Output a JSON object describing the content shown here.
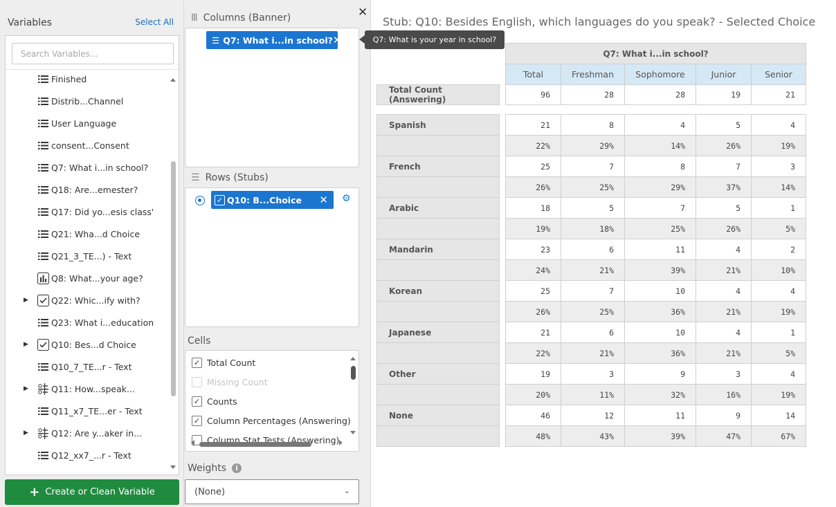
{
  "variables_panel": {
    "title": "Variables",
    "select_all": "Select All",
    "search_placeholder": "Search Variables...",
    "items": [
      {
        "label": "Finished",
        "icon": "list-icon",
        "expandable": false
      },
      {
        "label": "Distrib...Channel",
        "icon": "list-icon",
        "expandable": false
      },
      {
        "label": "User Language",
        "icon": "list-icon",
        "expandable": false
      },
      {
        "label": "consent...Consent",
        "icon": "list-icon",
        "expandable": false
      },
      {
        "label": "Q7: What i...in school?",
        "icon": "list-icon",
        "expandable": false
      },
      {
        "label": "Q18: Are...emester?",
        "icon": "list-icon",
        "expandable": false
      },
      {
        "label": "Q17: Did yo...esis class'",
        "icon": "list-icon",
        "expandable": false
      },
      {
        "label": "Q21: Wha...d Choice",
        "icon": "list-icon",
        "expandable": false
      },
      {
        "label": "Q21_3_TE...) - Text",
        "icon": "list-icon",
        "expandable": false
      },
      {
        "label": "Q8: What...your age?",
        "icon": "bar-chart-icon",
        "expandable": false
      },
      {
        "label": "Q22: Whic...ify with?",
        "icon": "checkbox-icon",
        "expandable": true
      },
      {
        "label": "Q23: What i...education",
        "icon": "list-icon",
        "expandable": false
      },
      {
        "label": "Q10: Bes...d Choice",
        "icon": "checkbox-icon",
        "expandable": true
      },
      {
        "label": "Q10_7_TE...r - Text",
        "icon": "list-icon",
        "expandable": false
      },
      {
        "label": "Q11: How...speak...",
        "icon": "matrix-icon",
        "expandable": true
      },
      {
        "label": "Q11_x7_TE...er - Text",
        "icon": "list-icon",
        "expandable": false
      },
      {
        "label": "Q12: Are y...aker in...",
        "icon": "matrix-icon",
        "expandable": true
      },
      {
        "label": "Q12_xx7_...r - Text",
        "icon": "list-icon",
        "expandable": false
      }
    ],
    "create_button": "Create or Clean Variable"
  },
  "columns_section": {
    "title": "Columns (Banner)",
    "chip_label": "Q7: What i...in school?",
    "tooltip": "Q7: What is your year in school?"
  },
  "rows_section": {
    "title": "Rows (Stubs)",
    "chip_label": "Q10: B...Choice"
  },
  "cells_section": {
    "title": "Cells",
    "options": [
      {
        "label": "Total Count",
        "checked": true,
        "disabled": false
      },
      {
        "label": "Missing Count",
        "checked": false,
        "disabled": true
      },
      {
        "label": "Counts",
        "checked": true,
        "disabled": false
      },
      {
        "label": "Column Percentages (Answering)",
        "checked": true,
        "disabled": false
      },
      {
        "label": "Column Stat Tests (Answering)",
        "checked": false,
        "disabled": false
      }
    ]
  },
  "weights_section": {
    "title": "Weights",
    "selected": "(None)"
  },
  "table": {
    "title": "Stub: Q10: Besides English, which languages do you speak? - Selected Choice",
    "banner": "Q7: What i...in school?",
    "columns": [
      "Total",
      "Freshman",
      "Sophomore",
      "Junior",
      "Senior"
    ],
    "total_label": "Total Count (Answering)",
    "totals": [
      "96",
      "28",
      "28",
      "19",
      "21"
    ],
    "rows": [
      {
        "label": "Spanish",
        "counts": [
          "21",
          "8",
          "4",
          "5",
          "4"
        ],
        "pcts": [
          "22%",
          "29%",
          "14%",
          "26%",
          "19%"
        ]
      },
      {
        "label": "French",
        "counts": [
          "25",
          "7",
          "8",
          "7",
          "3"
        ],
        "pcts": [
          "26%",
          "25%",
          "29%",
          "37%",
          "14%"
        ]
      },
      {
        "label": "Arabic",
        "counts": [
          "18",
          "5",
          "7",
          "5",
          "1"
        ],
        "pcts": [
          "19%",
          "18%",
          "25%",
          "26%",
          "5%"
        ]
      },
      {
        "label": "Mandarin",
        "counts": [
          "23",
          "6",
          "11",
          "4",
          "2"
        ],
        "pcts": [
          "24%",
          "21%",
          "39%",
          "21%",
          "10%"
        ]
      },
      {
        "label": "Korean",
        "counts": [
          "25",
          "7",
          "10",
          "4",
          "4"
        ],
        "pcts": [
          "26%",
          "25%",
          "36%",
          "21%",
          "19%"
        ]
      },
      {
        "label": "Japanese",
        "counts": [
          "21",
          "6",
          "10",
          "4",
          "1"
        ],
        "pcts": [
          "22%",
          "21%",
          "36%",
          "21%",
          "5%"
        ]
      },
      {
        "label": "Other",
        "counts": [
          "19",
          "3",
          "9",
          "3",
          "4"
        ],
        "pcts": [
          "20%",
          "11%",
          "32%",
          "16%",
          "19%"
        ]
      },
      {
        "label": "None",
        "counts": [
          "46",
          "12",
          "11",
          "9",
          "14"
        ],
        "pcts": [
          "48%",
          "43%",
          "39%",
          "47%",
          "67%"
        ]
      }
    ]
  },
  "colors": {
    "accent": "#1b76d0",
    "create_button": "#1f8b3f",
    "column_header": "#d5e8f5"
  }
}
